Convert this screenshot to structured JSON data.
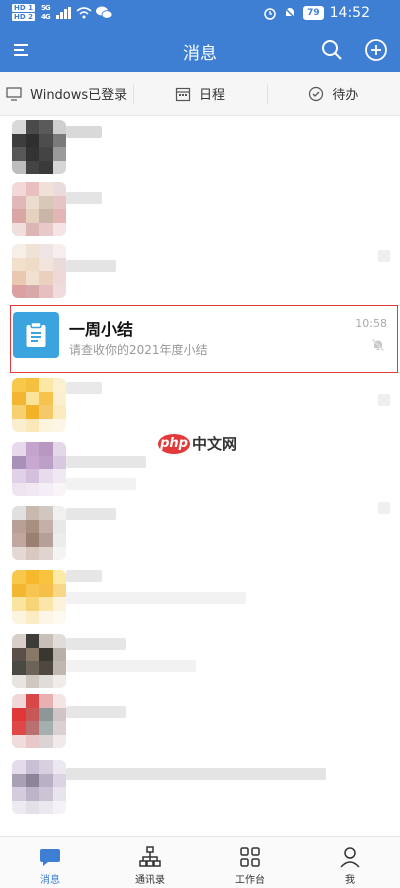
{
  "status_bar": {
    "sim1": "HD 1",
    "sim2": "HD 2",
    "sig1": "5G",
    "sig2": "4G",
    "battery": "79",
    "time": "14:52"
  },
  "header": {
    "title": "消息"
  },
  "quick_tabs": [
    {
      "label": "Windows已登录",
      "icon": "monitor-icon"
    },
    {
      "label": "日程",
      "icon": "calendar-icon"
    },
    {
      "label": "待办",
      "icon": "check-circle-icon"
    }
  ],
  "highlighted_item": {
    "name": "一周小结",
    "preview": "请查收你的2021年度小结",
    "time": "10:58",
    "icon": "clipboard-icon",
    "muted_icon": "bell-off-icon"
  },
  "watermark": {
    "logo": "php",
    "text": "中文网"
  },
  "bottom_nav": [
    {
      "label": "消息",
      "icon": "chat-bubble-icon",
      "active": true
    },
    {
      "label": "通讯录",
      "icon": "org-chart-icon",
      "active": false
    },
    {
      "label": "工作台",
      "icon": "grid-icon",
      "active": false
    },
    {
      "label": "我",
      "icon": "person-icon",
      "active": false
    }
  ],
  "colors": {
    "brand": "#3e7fd3",
    "highlight_border": "#e23a3a",
    "avatar_blue": "#3ba4df"
  }
}
